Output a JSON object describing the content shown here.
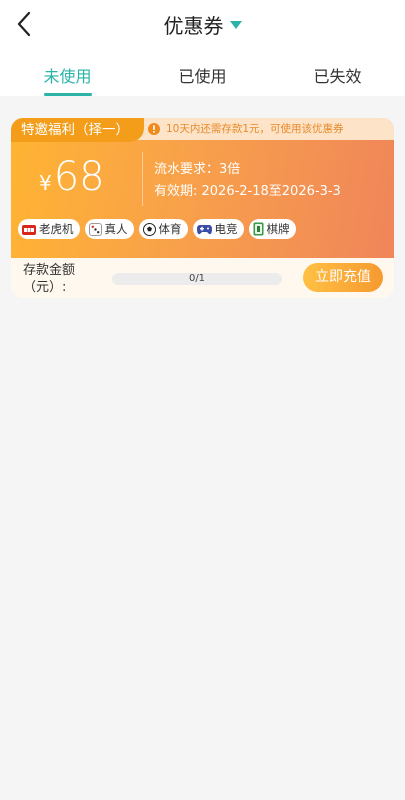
{
  "header": {
    "title": "优惠券",
    "back_icon": "chevron-left-icon",
    "dropdown_icon": "caret-down-icon",
    "accent_color": "#2bb3a8"
  },
  "tabs": [
    {
      "label": "未使用",
      "active": true
    },
    {
      "label": "已使用",
      "active": false
    },
    {
      "label": "已失效",
      "active": false
    }
  ],
  "coupon": {
    "badge": "特邀福利（择一）",
    "notice": "10天内还需存款1元，可使用该优惠券",
    "currency": "¥",
    "amount": "68",
    "requirement": "流水要求：3倍",
    "validity": "有效期: 2026-2-18至2026-3-3",
    "categories": [
      {
        "label": "老虎机",
        "icon": "slot-machine-icon"
      },
      {
        "label": "真人",
        "icon": "dice-icon"
      },
      {
        "label": "体育",
        "icon": "soccer-ball-icon"
      },
      {
        "label": "电竞",
        "icon": "gamepad-icon"
      },
      {
        "label": "棋牌",
        "icon": "mahjong-tile-icon"
      }
    ],
    "deposit_label": "存款金额（元）:",
    "progress_text": "0/1",
    "progress_fraction": 0,
    "action_label": "立即充值"
  }
}
